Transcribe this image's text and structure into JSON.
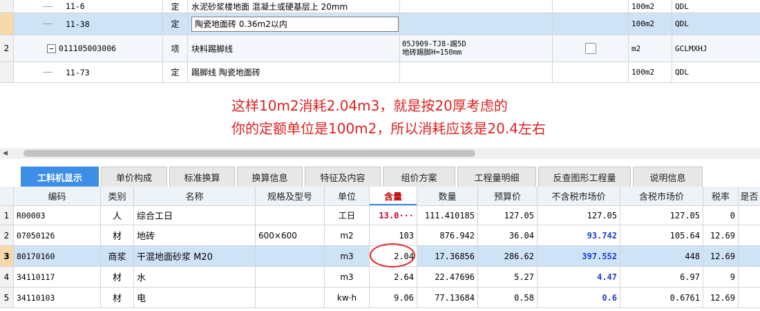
{
  "top_table": {
    "rows": [
      {
        "idx": "",
        "code": "11-6",
        "type": "定",
        "name": "水泥砂浆楼地面 混凝土或硬基层上 20mm",
        "spec": [
          "",
          ""
        ],
        "unit": "100m2",
        "rule": "QDL"
      },
      {
        "idx": "",
        "code": "11-38",
        "type": "定",
        "name": "陶瓷地面砖 0.36m2以内",
        "spec": [
          "",
          ""
        ],
        "unit": "100m2",
        "rule": "QDL"
      },
      {
        "idx": "2",
        "code": "011105003006",
        "type": "项",
        "name": "块料踢脚线",
        "spec": [
          "05J909-TJ8-踢5D",
          "地砖踢脚H=150mm"
        ],
        "unit": "m2",
        "rule": "GCLMXHJ"
      },
      {
        "idx": "",
        "code": "11-73",
        "type": "定",
        "name": "踢脚线 陶瓷地面砖",
        "spec": [
          "",
          ""
        ],
        "unit": "100m2",
        "rule": "QDL"
      }
    ]
  },
  "annotation": {
    "line1": "这样10m2消耗2.04m3，就是按20厚考虑的",
    "line2": "你的定额单位是100m2，所以消耗应该是20.4左右"
  },
  "tabs": [
    "工料机显示",
    "单价构成",
    "标准换算",
    "换算信息",
    "特征及内容",
    "组价方案",
    "工程量明细",
    "反查图形工程量",
    "说明信息"
  ],
  "bottom_table": {
    "headers": {
      "code": "编码",
      "type": "类别",
      "name": "名称",
      "spec": "规格及型号",
      "unit": "单位",
      "qty": "含量",
      "amount": "数量",
      "budget": "预算价",
      "notax": "不含税市场价",
      "tax": "含税市场价",
      "rate": "税率",
      "last": "是否"
    },
    "rows": [
      {
        "idx": "1",
        "code": "R00003",
        "type": "人",
        "name": "综合工日",
        "spec": "",
        "unit": "工日",
        "qty": "13.0···",
        "amount": "111.410185",
        "budget": "127.05",
        "notax": "127.05",
        "tax": "127.05",
        "rate": "0"
      },
      {
        "idx": "2",
        "code": "07050126",
        "type": "材",
        "name": "地砖",
        "spec": "600×600",
        "unit": "m2",
        "qty": "103",
        "amount": "876.942",
        "budget": "36.04",
        "notax": "93.742",
        "tax": "105.64",
        "rate": "12.69"
      },
      {
        "idx": "3",
        "code": "80170160",
        "type": "商浆",
        "name": "干混地面砂浆 M20",
        "spec": "",
        "unit": "m3",
        "qty": "2.04",
        "amount": "17.36856",
        "budget": "286.62",
        "notax": "397.552",
        "tax": "448",
        "rate": "12.69"
      },
      {
        "idx": "4",
        "code": "34110117",
        "type": "材",
        "name": "水",
        "spec": "",
        "unit": "m3",
        "qty": "2.64",
        "amount": "22.47696",
        "budget": "5.27",
        "notax": "4.47",
        "tax": "6.97",
        "rate": "9"
      },
      {
        "idx": "5",
        "code": "34110103",
        "type": "材",
        "name": "电",
        "spec": "",
        "unit": "kw·h",
        "qty": "9.06",
        "amount": "77.13684",
        "budget": "0.58",
        "notax": "0.6",
        "tax": "0.6761",
        "rate": "12.69"
      }
    ]
  },
  "colors": {
    "accent": "#3c8ee6",
    "selection": "#cfe3f7",
    "annotation": "#e02020",
    "market_price": "#1e3cd0",
    "qty_warn": "#d0002a"
  }
}
